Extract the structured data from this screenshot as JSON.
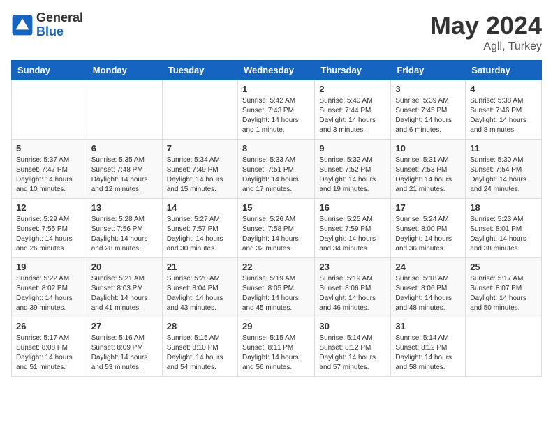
{
  "header": {
    "logo_general": "General",
    "logo_blue": "Blue",
    "month_title": "May 2024",
    "location": "Agli, Turkey"
  },
  "days_of_week": [
    "Sunday",
    "Monday",
    "Tuesday",
    "Wednesday",
    "Thursday",
    "Friday",
    "Saturday"
  ],
  "weeks": [
    [
      {
        "day": "",
        "info": ""
      },
      {
        "day": "",
        "info": ""
      },
      {
        "day": "",
        "info": ""
      },
      {
        "day": "1",
        "info": "Sunrise: 5:42 AM\nSunset: 7:43 PM\nDaylight: 14 hours\nand 1 minute."
      },
      {
        "day": "2",
        "info": "Sunrise: 5:40 AM\nSunset: 7:44 PM\nDaylight: 14 hours\nand 3 minutes."
      },
      {
        "day": "3",
        "info": "Sunrise: 5:39 AM\nSunset: 7:45 PM\nDaylight: 14 hours\nand 6 minutes."
      },
      {
        "day": "4",
        "info": "Sunrise: 5:38 AM\nSunset: 7:46 PM\nDaylight: 14 hours\nand 8 minutes."
      }
    ],
    [
      {
        "day": "5",
        "info": "Sunrise: 5:37 AM\nSunset: 7:47 PM\nDaylight: 14 hours\nand 10 minutes."
      },
      {
        "day": "6",
        "info": "Sunrise: 5:35 AM\nSunset: 7:48 PM\nDaylight: 14 hours\nand 12 minutes."
      },
      {
        "day": "7",
        "info": "Sunrise: 5:34 AM\nSunset: 7:49 PM\nDaylight: 14 hours\nand 15 minutes."
      },
      {
        "day": "8",
        "info": "Sunrise: 5:33 AM\nSunset: 7:51 PM\nDaylight: 14 hours\nand 17 minutes."
      },
      {
        "day": "9",
        "info": "Sunrise: 5:32 AM\nSunset: 7:52 PM\nDaylight: 14 hours\nand 19 minutes."
      },
      {
        "day": "10",
        "info": "Sunrise: 5:31 AM\nSunset: 7:53 PM\nDaylight: 14 hours\nand 21 minutes."
      },
      {
        "day": "11",
        "info": "Sunrise: 5:30 AM\nSunset: 7:54 PM\nDaylight: 14 hours\nand 24 minutes."
      }
    ],
    [
      {
        "day": "12",
        "info": "Sunrise: 5:29 AM\nSunset: 7:55 PM\nDaylight: 14 hours\nand 26 minutes."
      },
      {
        "day": "13",
        "info": "Sunrise: 5:28 AM\nSunset: 7:56 PM\nDaylight: 14 hours\nand 28 minutes."
      },
      {
        "day": "14",
        "info": "Sunrise: 5:27 AM\nSunset: 7:57 PM\nDaylight: 14 hours\nand 30 minutes."
      },
      {
        "day": "15",
        "info": "Sunrise: 5:26 AM\nSunset: 7:58 PM\nDaylight: 14 hours\nand 32 minutes."
      },
      {
        "day": "16",
        "info": "Sunrise: 5:25 AM\nSunset: 7:59 PM\nDaylight: 14 hours\nand 34 minutes."
      },
      {
        "day": "17",
        "info": "Sunrise: 5:24 AM\nSunset: 8:00 PM\nDaylight: 14 hours\nand 36 minutes."
      },
      {
        "day": "18",
        "info": "Sunrise: 5:23 AM\nSunset: 8:01 PM\nDaylight: 14 hours\nand 38 minutes."
      }
    ],
    [
      {
        "day": "19",
        "info": "Sunrise: 5:22 AM\nSunset: 8:02 PM\nDaylight: 14 hours\nand 39 minutes."
      },
      {
        "day": "20",
        "info": "Sunrise: 5:21 AM\nSunset: 8:03 PM\nDaylight: 14 hours\nand 41 minutes."
      },
      {
        "day": "21",
        "info": "Sunrise: 5:20 AM\nSunset: 8:04 PM\nDaylight: 14 hours\nand 43 minutes."
      },
      {
        "day": "22",
        "info": "Sunrise: 5:19 AM\nSunset: 8:05 PM\nDaylight: 14 hours\nand 45 minutes."
      },
      {
        "day": "23",
        "info": "Sunrise: 5:19 AM\nSunset: 8:06 PM\nDaylight: 14 hours\nand 46 minutes."
      },
      {
        "day": "24",
        "info": "Sunrise: 5:18 AM\nSunset: 8:06 PM\nDaylight: 14 hours\nand 48 minutes."
      },
      {
        "day": "25",
        "info": "Sunrise: 5:17 AM\nSunset: 8:07 PM\nDaylight: 14 hours\nand 50 minutes."
      }
    ],
    [
      {
        "day": "26",
        "info": "Sunrise: 5:17 AM\nSunset: 8:08 PM\nDaylight: 14 hours\nand 51 minutes."
      },
      {
        "day": "27",
        "info": "Sunrise: 5:16 AM\nSunset: 8:09 PM\nDaylight: 14 hours\nand 53 minutes."
      },
      {
        "day": "28",
        "info": "Sunrise: 5:15 AM\nSunset: 8:10 PM\nDaylight: 14 hours\nand 54 minutes."
      },
      {
        "day": "29",
        "info": "Sunrise: 5:15 AM\nSunset: 8:11 PM\nDaylight: 14 hours\nand 56 minutes."
      },
      {
        "day": "30",
        "info": "Sunrise: 5:14 AM\nSunset: 8:12 PM\nDaylight: 14 hours\nand 57 minutes."
      },
      {
        "day": "31",
        "info": "Sunrise: 5:14 AM\nSunset: 8:12 PM\nDaylight: 14 hours\nand 58 minutes."
      },
      {
        "day": "",
        "info": ""
      }
    ]
  ]
}
